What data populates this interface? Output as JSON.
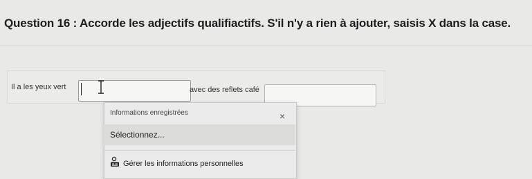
{
  "question": {
    "number_label": "Question 16 :",
    "instruction": "Accorde les adjectifs qualifiactifs. S'il n'y a rien à ajouter, saisis X dans la case."
  },
  "sentence": {
    "part1": "Il a les yeux vert",
    "part2": "avec des reflets café"
  },
  "fields": {
    "field1_value": "",
    "field2_value": ""
  },
  "autofill": {
    "header": "Informations enregistrées",
    "close_symbol": "×",
    "option": "Sélectionnez...",
    "manage": "Gérer les informations personnelles"
  },
  "icons": {
    "close": "close-icon",
    "manage": "person-id-icon",
    "cursor": "ibeam-cursor-icon"
  }
}
